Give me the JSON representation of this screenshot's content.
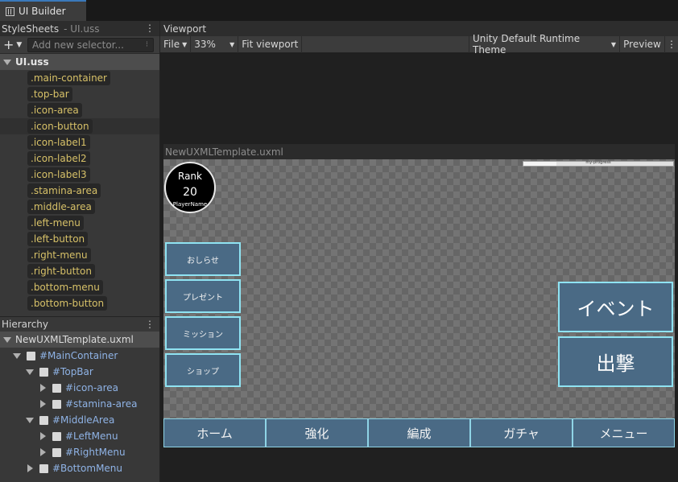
{
  "window_tab": {
    "title": "UI Builder",
    "icon": "ui-builder-icon"
  },
  "stylesheets": {
    "title": "StyleSheets",
    "file": "- UI.uss",
    "search_placeholder": "Add new selector...",
    "uss_file": "UI.uss",
    "selectors": [
      ".main-container",
      ".top-bar",
      ".icon-area",
      ".icon-button",
      ".icon-label1",
      ".icon-label2",
      ".icon-label3",
      ".stamina-area",
      ".middle-area",
      ".left-menu",
      ".left-button",
      ".right-menu",
      ".right-button",
      ".bottom-menu",
      ".bottom-button"
    ]
  },
  "hierarchy": {
    "title": "Hierarchy",
    "root": "NewUXMLTemplate.uxml",
    "nodes": [
      {
        "label": "#MainContainer",
        "depth": 1,
        "expanded": true
      },
      {
        "label": "#TopBar",
        "depth": 2,
        "expanded": true
      },
      {
        "label": "#icon-area",
        "depth": 3,
        "expanded": false
      },
      {
        "label": "#stamina-area",
        "depth": 3,
        "expanded": false
      },
      {
        "label": "#MiddleArea",
        "depth": 2,
        "expanded": true
      },
      {
        "label": "#LeftMenu",
        "depth": 3,
        "expanded": false
      },
      {
        "label": "#RightMenu",
        "depth": 3,
        "expanded": false
      },
      {
        "label": "#BottomMenu",
        "depth": 2,
        "expanded": false
      }
    ]
  },
  "viewport": {
    "title": "Viewport",
    "file_menu": "File",
    "zoom": "33%",
    "fit": "Fit viewport",
    "theme": "Unity Default Runtime Theme",
    "preview": "Preview",
    "document_title": "NewUXMLTemplate.uxml"
  },
  "game_ui": {
    "rank_label": "Rank",
    "rank_value": "20",
    "player_name": "PlayerName",
    "progress_text": "my-progress",
    "progress_fraction": 0.22,
    "left_buttons": [
      "おしらせ",
      "プレゼント",
      "ミッション",
      "ショップ"
    ],
    "right_buttons": [
      "イベント",
      "出撃"
    ],
    "bottom_buttons": [
      "ホーム",
      "強化",
      "編成",
      "ガチャ",
      "メニュー"
    ]
  }
}
